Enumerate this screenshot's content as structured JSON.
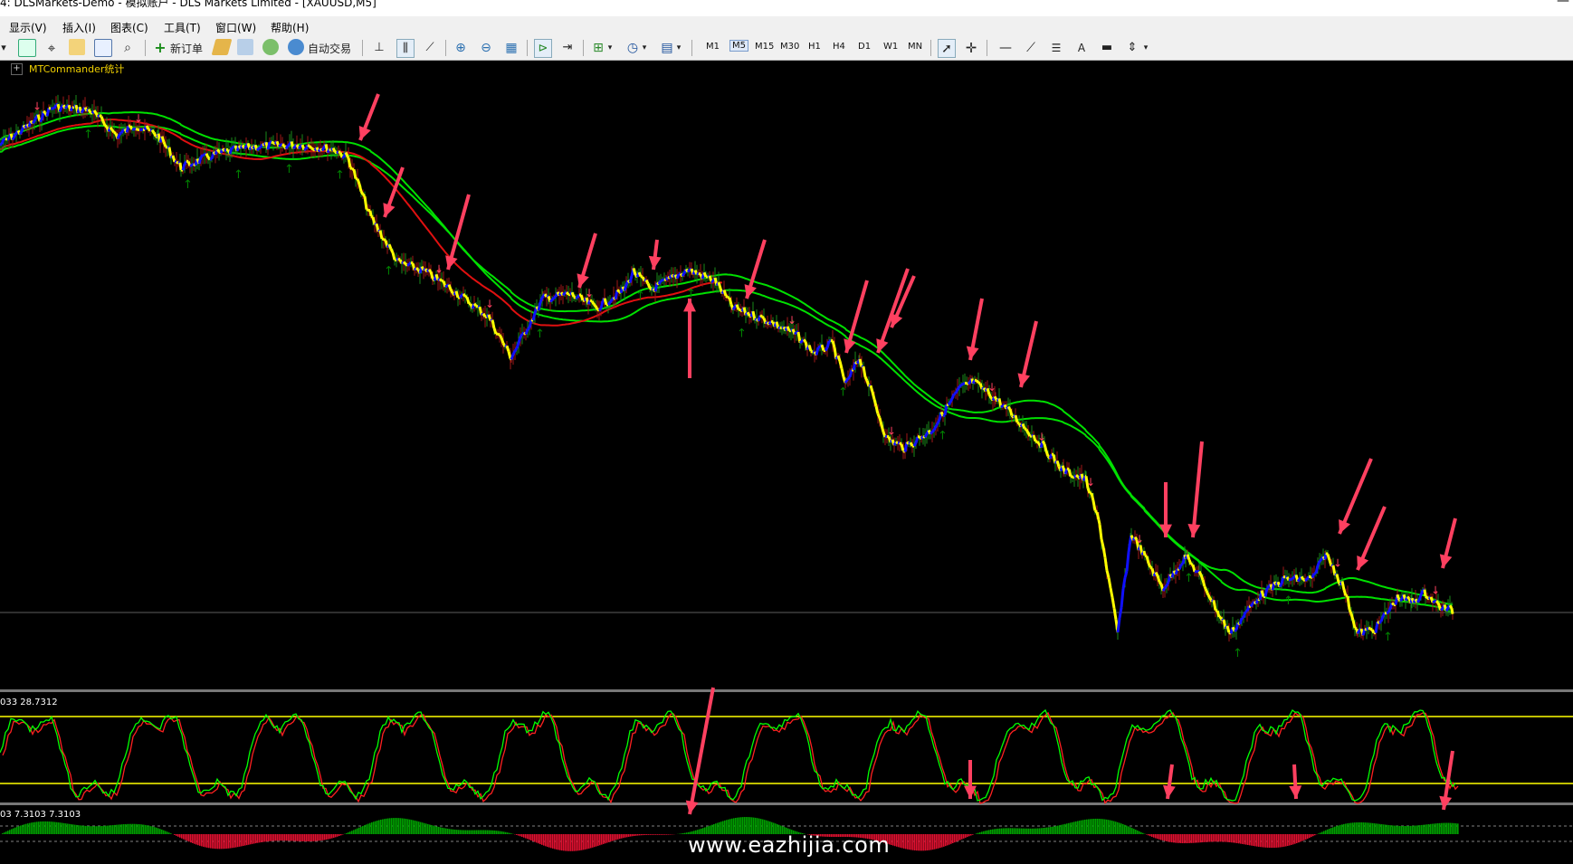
{
  "window": {
    "title": "4: DLSMarkets-Demo - 模拟账户 - DLS Markets Limited - [XAUUSD,M5]",
    "minimize_glyph": "—"
  },
  "menu": [
    {
      "label": "显示(V)"
    },
    {
      "label": "插入(I)"
    },
    {
      "label": "图表(C)"
    },
    {
      "label": "工具(T)"
    },
    {
      "label": "窗口(W)"
    },
    {
      "label": "帮助(H)"
    }
  ],
  "toolbar": {
    "new_order_label": "新订单",
    "auto_trade_label": "自动交易",
    "timeframes": [
      "M1",
      "M5",
      "M15",
      "M30",
      "H1",
      "H4",
      "D1",
      "W1",
      "MN"
    ],
    "active_timeframe": "M5",
    "text_tool_label": "A",
    "icons": [
      "new-chart-icon",
      "profiles-icon",
      "crosshair-icon",
      "market-watch-icon",
      "navigator-icon",
      "terminal-icon",
      "strategy-tester-icon",
      "new-order-icon",
      "metaeditor-icon",
      "history-icon",
      "signals-icon",
      "auto-trading-icon",
      "bar-chart-icon",
      "candlestick-icon",
      "line-chart-icon",
      "zoom-in-icon",
      "zoom-out-icon",
      "tile-windows-icon",
      "auto-scroll-icon",
      "chart-shift-icon",
      "indicators-icon",
      "periods-icon",
      "templates-icon",
      "cursor-icon",
      "cross-icon",
      "horizontal-line-icon",
      "trendline-icon",
      "fibonacci-icon",
      "text-icon",
      "label-icon",
      "arrows-icon"
    ]
  },
  "chart": {
    "symbol": "XAUUSD",
    "period": "M5",
    "indicator_label": "MTCommander统计",
    "plus_label": "+",
    "stoch_panel_label": "033 28.7312",
    "macd_panel_label": "03 7.3103 7.3103",
    "colors": {
      "background": "#000000",
      "ma_green": "#00e000",
      "ma_red": "#e01010",
      "price_yellow": "#ffff00",
      "price_blue": "#1010ff",
      "arrow_red": "#ff4060",
      "arrow_green": "#008000",
      "stoch_green": "#00ff00",
      "stoch_red": "#ff2020",
      "level_yellow": "#ffff00",
      "hist_green": "#00a000",
      "hist_red": "#e01030"
    }
  },
  "watermark": "www.eazhijia.com"
}
